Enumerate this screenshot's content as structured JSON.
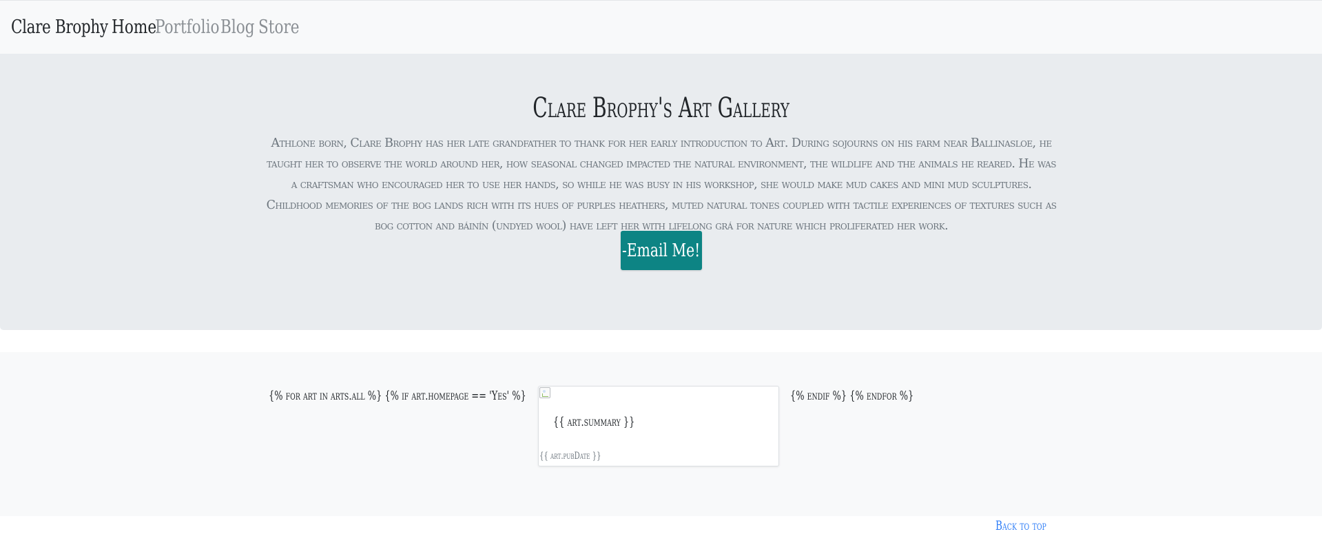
{
  "navbar": {
    "brand": "Clare Brophy",
    "items": [
      {
        "label": "Home",
        "active": true
      },
      {
        "label": "Portfolio",
        "active": false
      },
      {
        "label": "Blog",
        "active": false
      },
      {
        "label": "Store",
        "active": false
      }
    ]
  },
  "jumbotron": {
    "title": "Clare Brophy's Art Gallery",
    "lead": "Athlone born, Clare Brophy has her late grandfather to thank for her early introduction to Art. During sojourns on his farm near Ballinasloe, he taught her to observe the world around her, how seasonal changed impacted the natural environment, the wildlife and the animals he reared. He was a craftsman who encouraged her to use her hands, so while he was busy in his workshop, she would make mud cakes and mini mud sculptures. Childhood memories of the bog lands rich with its hues of purples heathers, muted natural tones coupled with tactile experiences of textures such as bog cotton and báinín (undyed wool) have left her with lifelong grá for nature which proliferated her work.",
    "email_button": "-Email Me!"
  },
  "gallery": {
    "template_open": "{% for art in arts.all %} {% if art.homepage == 'Yes' %}",
    "template_close": "{% endif %} {% endfor %}",
    "card": {
      "summary": "{{ art.summary }}",
      "pub_date": "{{ art.pubDate }}"
    }
  },
  "footer": {
    "back_to_top": "Back to top"
  },
  "colors": {
    "navbar_bg": "#f8f9fa",
    "jumbotron_bg": "#e9ecef",
    "button_bg": "#0d8484",
    "link": "#2f7ef7"
  }
}
